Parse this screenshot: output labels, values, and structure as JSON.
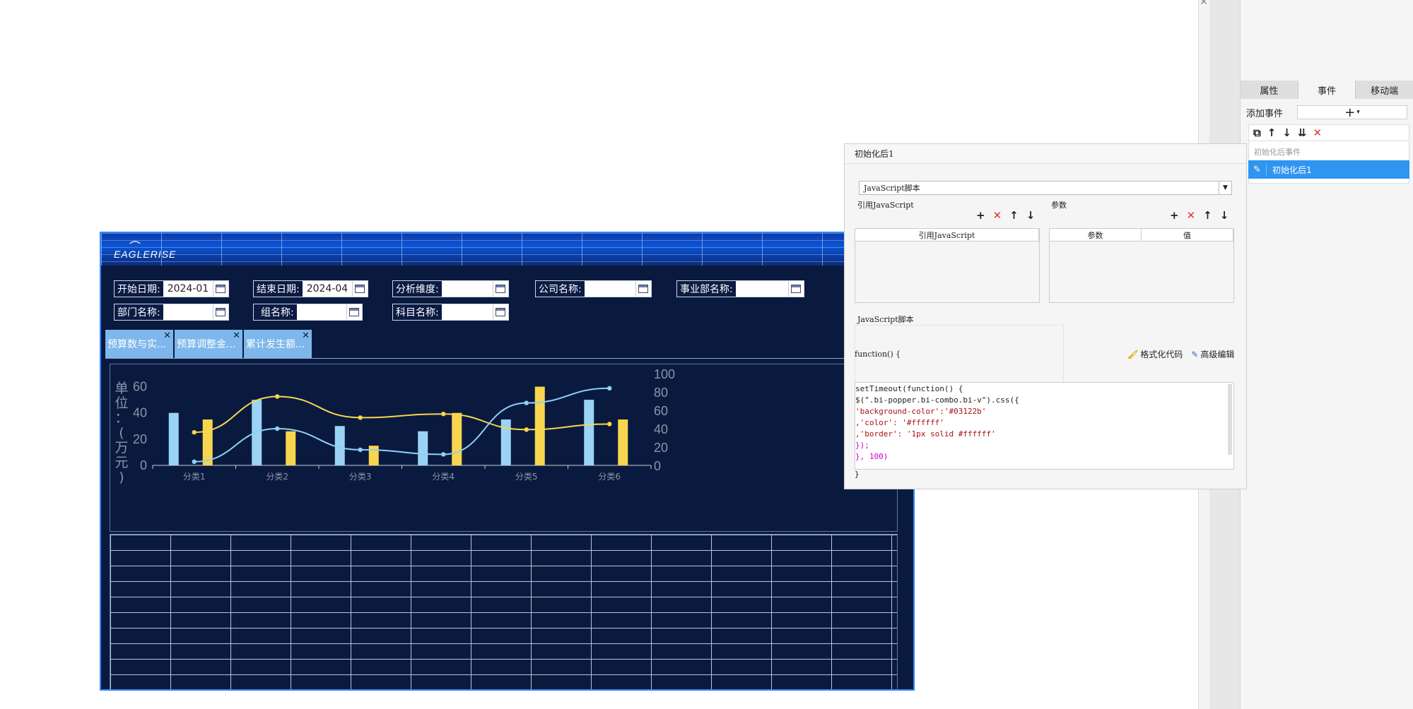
{
  "dashboard": {
    "logo": "EAGLERISE",
    "filters": {
      "start_date_label": "开始日期:",
      "start_date_value": "2024-01",
      "end_date_label": "结束日期:",
      "end_date_value": "2024-04",
      "dimension_label": "分析维度:",
      "company_label": "公司名称:",
      "division_label": "事业部名称:",
      "department_label": "部门名称:",
      "group_label": "组名称:",
      "subject_label": "科目名称:"
    },
    "tabs": [
      {
        "label": "预算数与实...",
        "close": "✕"
      },
      {
        "label": "预算调整金...",
        "close": "✕"
      },
      {
        "label": "累计发生额...",
        "close": "✕"
      }
    ]
  },
  "chart_data": {
    "type": "bar",
    "categories": [
      "分类1",
      "分类2",
      "分类3",
      "分类4",
      "分类5",
      "分类6"
    ],
    "ylabel": "单位：(万元)",
    "ylim": [
      0,
      70
    ],
    "y_ticks": [
      "0",
      "20",
      "40",
      "60"
    ],
    "y2lim": [
      0,
      100
    ],
    "y2_ticks": [
      "0",
      "20",
      "40",
      "60",
      "80",
      "100"
    ],
    "series": [
      {
        "type": "bar",
        "axis": "left",
        "color": "#9ad3f5",
        "values": [
          40,
          50,
          30,
          26,
          35,
          50
        ]
      },
      {
        "type": "bar",
        "axis": "left",
        "color": "#f8d54e",
        "values": [
          35,
          26,
          15,
          40,
          60,
          35
        ]
      },
      {
        "type": "line",
        "axis": "right",
        "color": "#f8d54e",
        "values": [
          36,
          75,
          52,
          56,
          39,
          45
        ]
      },
      {
        "type": "line",
        "axis": "right",
        "color": "#8fd0f7",
        "values": [
          4,
          40,
          17,
          12,
          68,
          84
        ]
      }
    ],
    "grid": false,
    "colors": {
      "axis_text": "#8b95a8",
      "bar1": "#9ad3f5",
      "bar2": "#f8d54e"
    }
  },
  "dialog": {
    "title": "初始化后1",
    "script_type": "JavaScript脚本",
    "ref_js_section": "引用JavaScript",
    "ref_js_column": "引用JavaScript",
    "params_section": "参数",
    "params_col1": "参数",
    "params_col2": "值",
    "script_section": "JavaScript脚本",
    "fn_header": "function() {",
    "format_code": "格式化代码",
    "advanced_edit": "高级编辑",
    "code_lines": [
      "setTimeout(function() {",
      "$(\".bi-popper.bi-combo.bi-v\").css({",
      "'background-color':'#03122b'",
      ",'color': '#ffffff'",
      ",'border': '1px solid #ffffff'",
      "});",
      "",
      "}, 100)"
    ],
    "closing_brace": "}"
  },
  "side_panel": {
    "tabs": [
      "属性",
      "事件",
      "移动端"
    ],
    "active_tab": "事件",
    "add_event_label": "添加事件",
    "add_symbol": "+",
    "group_label": "初始化后事件",
    "event_item": "初始化后1"
  }
}
